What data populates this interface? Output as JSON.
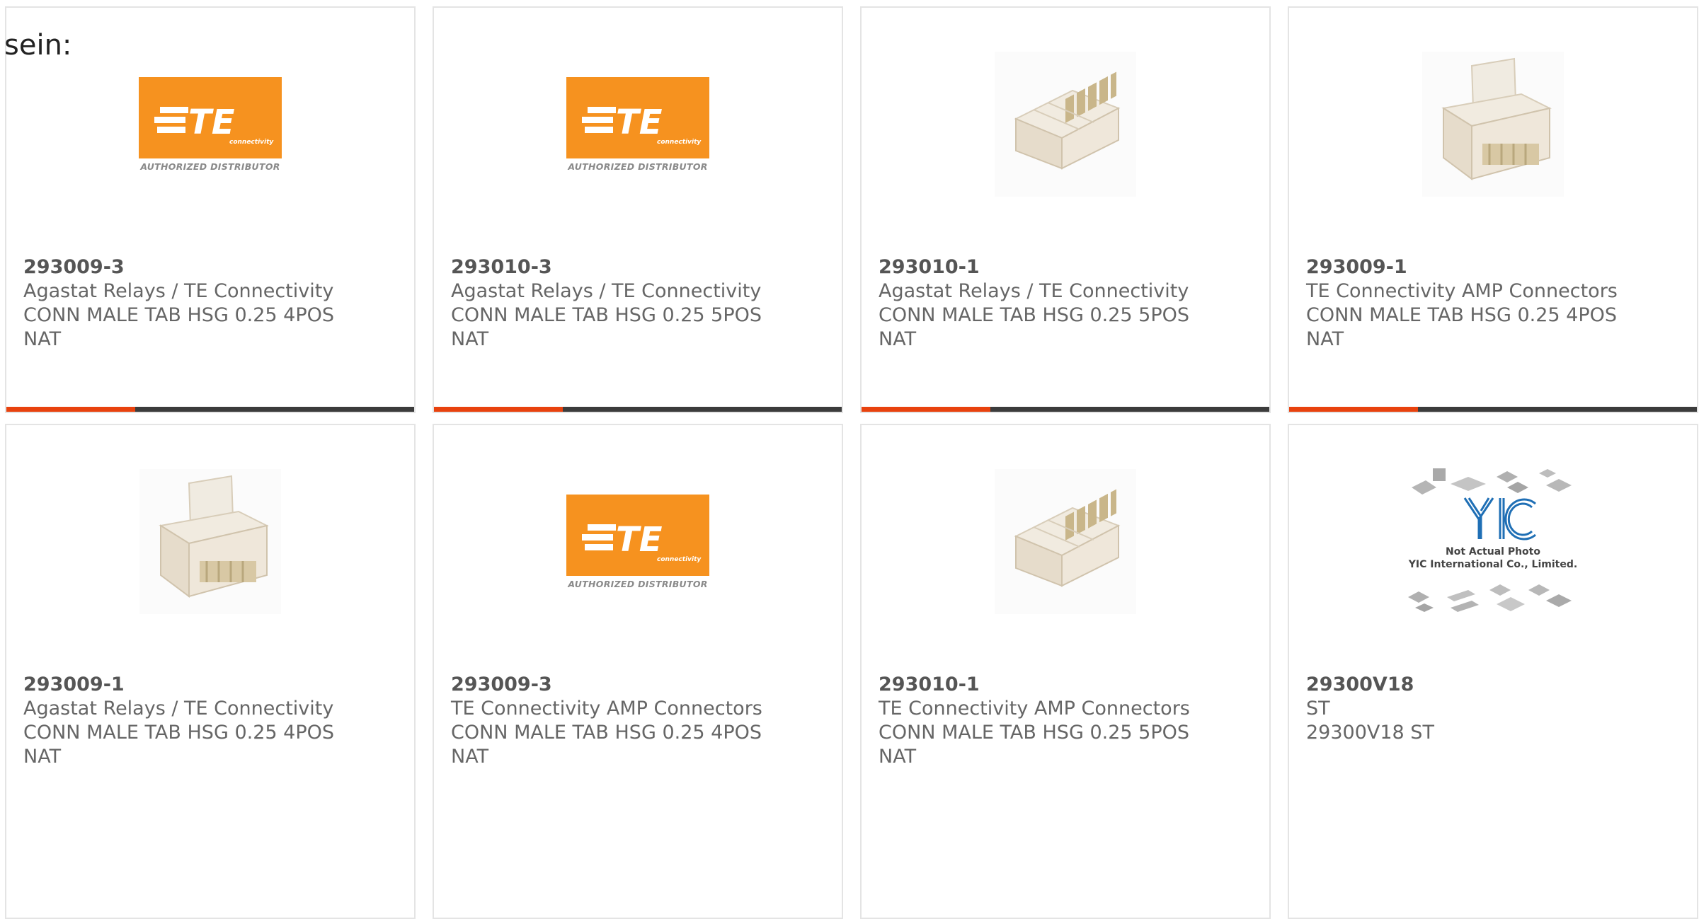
{
  "heading": "sein:",
  "logo_text": {
    "te": "TE",
    "connectivity": "connectivity",
    "distributor": "AUTHORIZED DISTRIBUTOR",
    "yic": "YIC",
    "yic_line1": "Not Actual Photo",
    "yic_line2": "YIC International Co., Limited."
  },
  "colors": {
    "te_orange": "#f6921f",
    "accent_red": "#e8420e",
    "bar_dark": "#3c3c3c",
    "text_gray": "#666666",
    "yic_blue": "#1f6fb5"
  },
  "products": [
    {
      "image": "te-logo",
      "part_number": "293009-3",
      "manufacturer": "Agastat Relays / TE Connectivity",
      "description": "CONN MALE TAB HSG 0.25 4POS",
      "description2": "NAT"
    },
    {
      "image": "te-logo",
      "part_number": "293010-3",
      "manufacturer": "Agastat Relays / TE Connectivity",
      "description": "CONN MALE TAB HSG 0.25 5POS",
      "description2": "NAT"
    },
    {
      "image": "connector-5pos",
      "part_number": "293010-1",
      "manufacturer": "Agastat Relays / TE Connectivity",
      "description": "CONN MALE TAB HSG 0.25 5POS",
      "description2": "NAT"
    },
    {
      "image": "connector-4pos",
      "part_number": "293009-1",
      "manufacturer": "TE Connectivity AMP Connectors",
      "description": "CONN MALE TAB HSG 0.25 4POS",
      "description2": "NAT"
    },
    {
      "image": "connector-4pos",
      "part_number": "293009-1",
      "manufacturer": "Agastat Relays / TE Connectivity",
      "description": "CONN MALE TAB HSG 0.25 4POS",
      "description2": "NAT"
    },
    {
      "image": "te-logo",
      "part_number": "293009-3",
      "manufacturer": "TE Connectivity AMP Connectors",
      "description": "CONN MALE TAB HSG 0.25 4POS",
      "description2": "NAT"
    },
    {
      "image": "connector-5pos",
      "part_number": "293010-1",
      "manufacturer": "TE Connectivity AMP Connectors",
      "description": "CONN MALE TAB HSG 0.25 5POS",
      "description2": "NAT"
    },
    {
      "image": "yic-placeholder",
      "part_number": "29300V18",
      "manufacturer": "ST",
      "description": "29300V18 ST",
      "description2": ""
    }
  ]
}
